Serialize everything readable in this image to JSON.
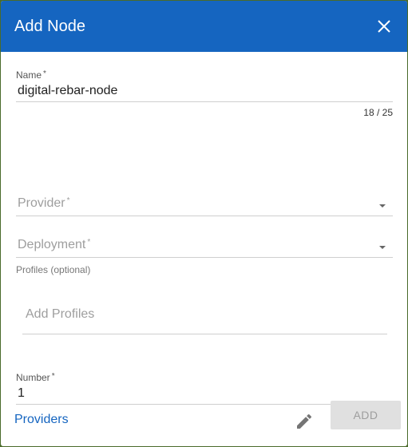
{
  "dialog": {
    "title": "Add Node",
    "close_icon": "close-icon"
  },
  "fields": {
    "name": {
      "label": "Name",
      "required_mark": "*",
      "value": "digital-rebar-node",
      "counter": "18 / 25"
    },
    "provider": {
      "placeholder": "Provider",
      "required_mark": "*"
    },
    "deployment": {
      "placeholder": "Deployment",
      "required_mark": "*"
    },
    "profiles": {
      "label": "Profiles (optional)",
      "placeholder": "Add Profiles"
    },
    "number": {
      "label": "Number",
      "required_mark": "*",
      "value": "1"
    }
  },
  "footer": {
    "providers_link": "Providers",
    "edit_icon": "pencil-icon",
    "add_label": "ADD"
  },
  "colors": {
    "header": "#1565c0",
    "link": "#1565c0",
    "disabled_button": "#e0e0e0"
  }
}
